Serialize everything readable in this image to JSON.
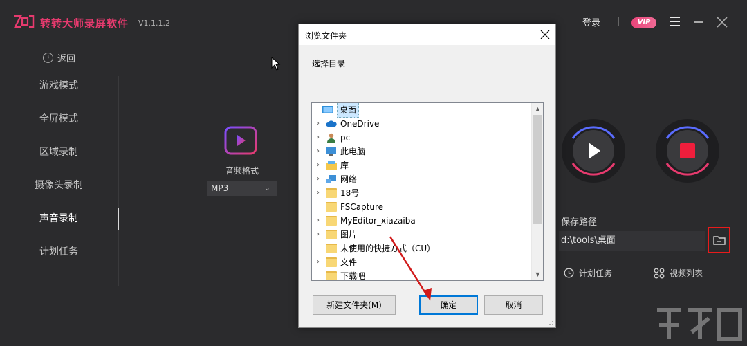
{
  "app": {
    "title": "转转大师录屏软件",
    "version": "V1.1.1.2",
    "login": "登录",
    "vip": "VIP",
    "accent_color": "#e63a6e"
  },
  "nav": {
    "back_label": "返回",
    "items": [
      {
        "label": "游戏模式",
        "active": false
      },
      {
        "label": "全屏模式",
        "active": false
      },
      {
        "label": "区域录制",
        "active": false
      },
      {
        "label": "摄像头录制",
        "active": false
      },
      {
        "label": "声音录制",
        "active": true
      },
      {
        "label": "计划任务",
        "active": false
      }
    ]
  },
  "audio": {
    "format_label": "音频格式",
    "format_value": "MP3"
  },
  "save": {
    "label": "保存路径",
    "path": "d:\\tools\\桌面"
  },
  "bottom_links": {
    "task": "计划任务",
    "video_list": "视频列表"
  },
  "dialog": {
    "title": "浏览文件夹",
    "prompt": "选择目录",
    "tree": [
      {
        "label": "桌面",
        "icon": "desktop-icon",
        "expandable": false,
        "indent": 0,
        "selected": true
      },
      {
        "label": "OneDrive",
        "icon": "cloud-icon",
        "expandable": true,
        "indent": 1,
        "selected": false
      },
      {
        "label": "pc",
        "icon": "user-icon",
        "expandable": true,
        "indent": 1,
        "selected": false
      },
      {
        "label": "此电脑",
        "icon": "computer-icon",
        "expandable": true,
        "indent": 1,
        "selected": false
      },
      {
        "label": "库",
        "icon": "library-icon",
        "expandable": true,
        "indent": 1,
        "selected": false
      },
      {
        "label": "网络",
        "icon": "network-icon",
        "expandable": true,
        "indent": 1,
        "selected": false
      },
      {
        "label": "18号",
        "icon": "folder-icon",
        "expandable": true,
        "indent": 1,
        "selected": false
      },
      {
        "label": "FSCapture",
        "icon": "folder-icon",
        "expandable": false,
        "indent": 1,
        "selected": false
      },
      {
        "label": "MyEditor_xiazaiba",
        "icon": "folder-icon",
        "expandable": true,
        "indent": 1,
        "selected": false
      },
      {
        "label": "图片",
        "icon": "folder-icon",
        "expandable": true,
        "indent": 1,
        "selected": false
      },
      {
        "label": "未使用的快捷方式（CU）",
        "icon": "folder-icon",
        "expandable": false,
        "indent": 1,
        "selected": false
      },
      {
        "label": "文件",
        "icon": "folder-icon",
        "expandable": true,
        "indent": 1,
        "selected": false
      },
      {
        "label": "下载吧",
        "icon": "folder-icon",
        "expandable": false,
        "indent": 1,
        "selected": false
      }
    ],
    "new_folder": "新建文件夹(M)",
    "ok": "确定",
    "cancel": "取消"
  }
}
